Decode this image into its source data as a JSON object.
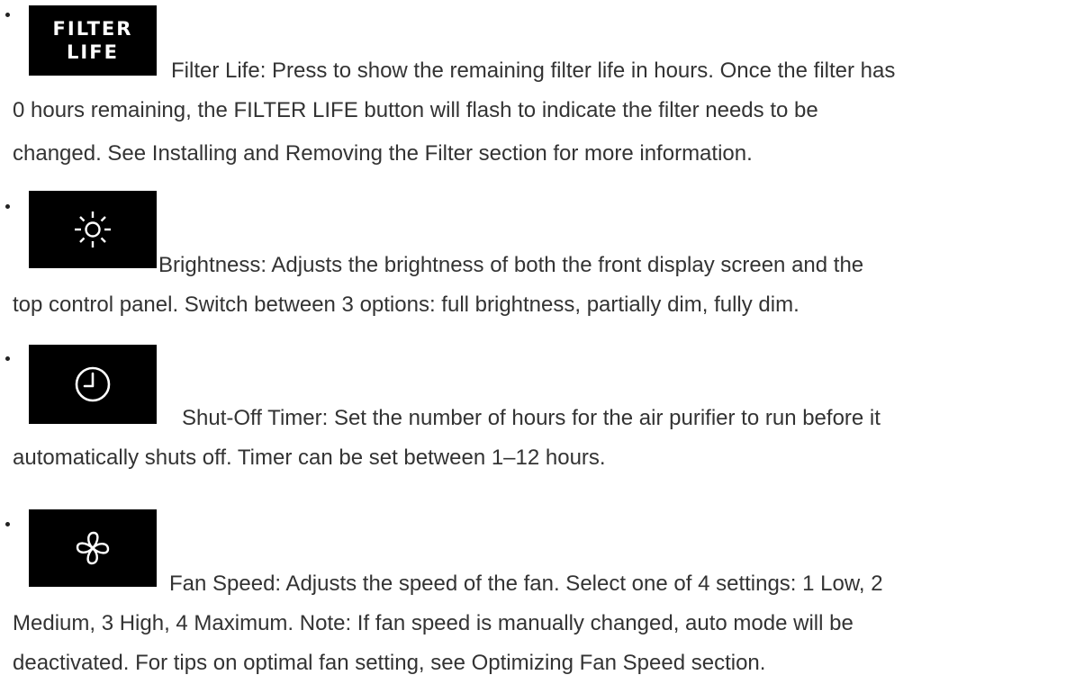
{
  "items": [
    {
      "icon": "filter-life-icon",
      "icon_text": [
        "FILTER",
        "LIFE"
      ],
      "lines": [
        "Filter Life: Press to show the remaining filter life in hours. Once the filter has",
        "0 hours remaining, the FILTER LIFE button will flash to indicate the filter needs to be",
        "changed. See Installing and Removing the Filter section for more information."
      ]
    },
    {
      "icon": "sun-icon",
      "lines": [
        "Brightness: Adjusts the brightness of both the front display screen and the",
        "top control panel. Switch between 3 options: full brightness, partially dim, fully dim."
      ]
    },
    {
      "icon": "clock-icon",
      "lines": [
        "Shut-Off Timer: Set the number of hours for the air purifier to run before it",
        "automatically shuts off. Timer can be set between 1–12 hours."
      ]
    },
    {
      "icon": "fan-icon",
      "lines": [
        "Fan Speed: Adjusts the speed of the fan. Select one of 4 settings: 1 Low, 2",
        "Medium, 3 High, 4 Maximum. Note: If fan speed is manually changed, auto mode will be",
        "deactivated. For tips on optimal fan setting, see Optimizing Fan Speed section."
      ]
    }
  ]
}
